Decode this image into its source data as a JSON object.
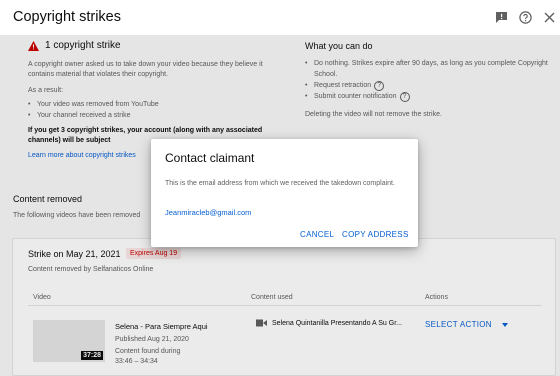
{
  "header": {
    "title": "Copyright strikes",
    "icons": [
      "feedback-icon",
      "help-icon",
      "close-icon"
    ]
  },
  "strike_info": {
    "heading": "1 copyright strike",
    "description": "A copyright owner asked us to take down your video because they believe it contains material that violates their copyright.",
    "as_result": "As a result:",
    "results": [
      "Your video was removed from YouTube",
      "Your channel received a strike"
    ],
    "warning": "If you get 3 copyright strikes, your account (along with any associated channels) will be subject",
    "learn_more": "Learn more about copyright strikes"
  },
  "what_you_can_do": {
    "title": "What you can do",
    "items": [
      "Do nothing. Strikes expire after 90 days, as long as you complete Copyright School.",
      "Request retraction",
      "Submit counter notification"
    ],
    "deleting_note": "Deleting the video will not remove the strike."
  },
  "content_removed": {
    "title": "Content removed",
    "description": "The following videos have been removed"
  },
  "strike_card": {
    "date": "Strike on May 21, 2021",
    "expires": "Expires Aug 19",
    "removed_by": "Content removed by Selfanaticos Online",
    "columns": [
      "Video",
      "Content used",
      "Actions"
    ],
    "video": {
      "title": "Selena - Para Siempre Aqui",
      "published": "Published Aug 21, 2020",
      "found_label": "Content found during",
      "found_range": "33:46 – 34:34",
      "duration": "37:28"
    },
    "content_used": "Selena Quintanilla Presentando A Su Gr...",
    "action_label": "SELECT ACTION"
  },
  "dialog": {
    "title": "Contact claimant",
    "body": "This is the email address from which we received the takedown complaint.",
    "email": "Jeanmiracleb@gmail.com",
    "cancel": "CANCEL",
    "copy": "COPY ADDRESS"
  },
  "colors": {
    "link": "#065fd4",
    "strike_red": "#cc0000",
    "badge_bg": "#fce8e8"
  }
}
